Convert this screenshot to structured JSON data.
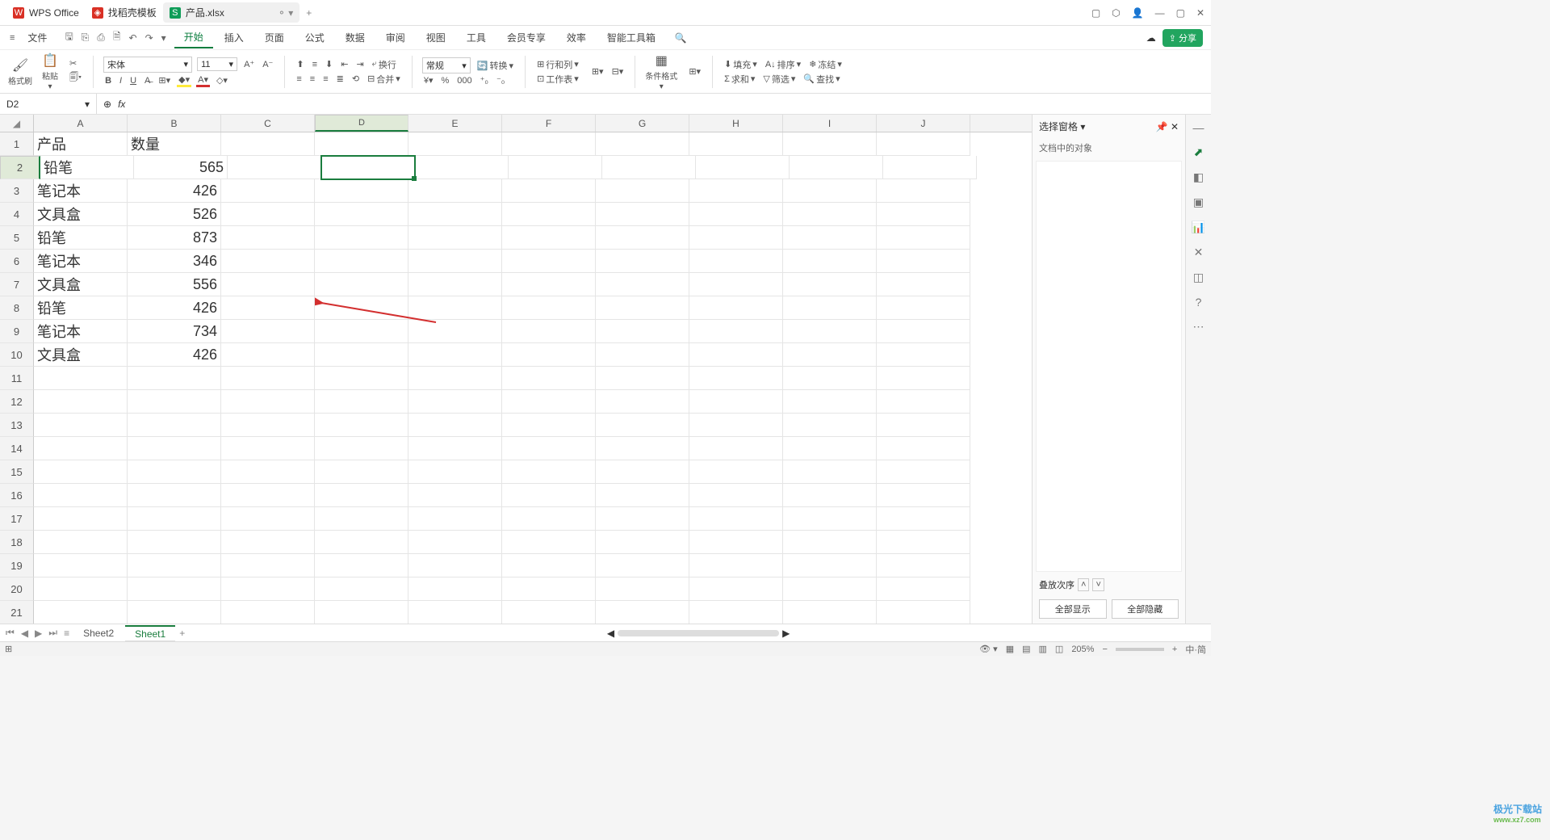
{
  "titlebar": {
    "app_name": "WPS Office",
    "tabs": [
      {
        "icon": "W",
        "label": "WPS Office"
      },
      {
        "icon": "❖",
        "label": "找稻壳模板"
      },
      {
        "icon": "S",
        "label": "产品.xlsx"
      }
    ],
    "add": "+"
  },
  "menubar": {
    "file": "文件",
    "items": [
      "开始",
      "插入",
      "页面",
      "公式",
      "数据",
      "审阅",
      "视图",
      "工具",
      "会员专享",
      "效率",
      "智能工具箱"
    ],
    "active": "开始",
    "cloud": "☁",
    "share": "分享"
  },
  "ribbon": {
    "format_painter": "格式刷",
    "paste": "粘贴",
    "font_family": "宋体",
    "font_size": "11",
    "number_fmt": "常规",
    "convert": "转换",
    "row_col": "行和列",
    "worksheet": "工作表",
    "cond_fmt": "条件格式",
    "fill": "填充",
    "sort": "排序",
    "freeze": "冻结",
    "sum": "求和",
    "filter": "筛选",
    "find": "查找",
    "wrap": "换行",
    "merge": "合并"
  },
  "namebox": {
    "cell": "D2",
    "fx": "fx"
  },
  "columns": [
    "A",
    "B",
    "C",
    "D",
    "E",
    "F",
    "G",
    "H",
    "I",
    "J"
  ],
  "sel_col": "D",
  "sel_row": 2,
  "rows": [
    {
      "n": 1,
      "a": "产品",
      "b": "数量"
    },
    {
      "n": 2,
      "a": "铅笔",
      "b": "565"
    },
    {
      "n": 3,
      "a": "笔记本",
      "b": "426"
    },
    {
      "n": 4,
      "a": "文具盒",
      "b": "526"
    },
    {
      "n": 5,
      "a": "铅笔",
      "b": "873"
    },
    {
      "n": 6,
      "a": "笔记本",
      "b": "346"
    },
    {
      "n": 7,
      "a": "文具盒",
      "b": "556"
    },
    {
      "n": 8,
      "a": "铅笔",
      "b": "426"
    },
    {
      "n": 9,
      "a": "笔记本",
      "b": "734"
    },
    {
      "n": 10,
      "a": "文具盒",
      "b": "426"
    },
    {
      "n": 11
    },
    {
      "n": 12
    },
    {
      "n": 13
    },
    {
      "n": 14
    },
    {
      "n": 15
    },
    {
      "n": 16
    },
    {
      "n": 17
    },
    {
      "n": 18
    },
    {
      "n": 19
    },
    {
      "n": 20
    },
    {
      "n": 21
    }
  ],
  "side": {
    "title": "选择窗格",
    "sub": "文档中的对象",
    "order": "叠放次序",
    "show": "全部显示",
    "hide": "全部隐藏"
  },
  "sheets": {
    "list": [
      "Sheet2",
      "Sheet1"
    ],
    "active": "Sheet1",
    "add": "+"
  },
  "status": {
    "zoom": "205%",
    "ime": "中·简"
  },
  "watermark": {
    "t1": "极光下载站",
    "t2": "www.xz7.com"
  }
}
